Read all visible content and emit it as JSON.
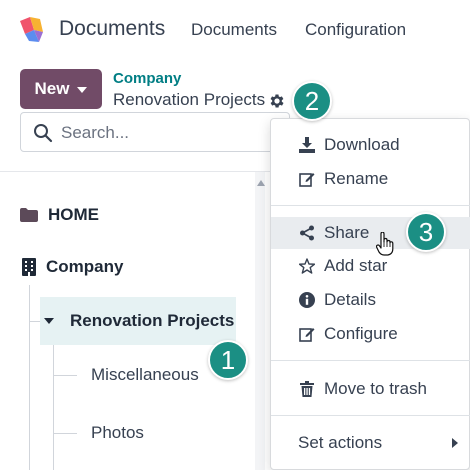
{
  "header": {
    "app_name": "Documents",
    "nav": [
      "Documents",
      "Configuration"
    ]
  },
  "control_panel": {
    "new_label": "New",
    "breadcrumb_parent": "Company",
    "breadcrumb_current": "Renovation Projects",
    "search_placeholder": "Search..."
  },
  "tree": {
    "items": [
      {
        "label": "HOME",
        "icon": "folder-icon"
      },
      {
        "label": "Company",
        "icon": "building-icon"
      },
      {
        "label": "Renovation Projects",
        "icon": "caret-down-icon",
        "selected": true
      },
      {
        "label": "Miscellaneous"
      },
      {
        "label": "Photos"
      }
    ]
  },
  "menu": {
    "items": [
      {
        "label": "Download",
        "icon": "download-icon"
      },
      {
        "label": "Rename",
        "icon": "edit-icon"
      },
      {
        "label": "Share",
        "icon": "share-icon",
        "hovered": true
      },
      {
        "label": "Add star",
        "icon": "star-icon"
      },
      {
        "label": "Details",
        "icon": "info-icon"
      },
      {
        "label": "Configure",
        "icon": "edit-icon"
      },
      {
        "label": "Move to trash",
        "icon": "trash-icon"
      },
      {
        "label": "Set actions",
        "icon": "caret-right-icon"
      }
    ]
  },
  "callouts": [
    "1",
    "2",
    "3"
  ],
  "colors": {
    "brand": "#714B67",
    "accent": "#017E84",
    "callout": "#1b8f84",
    "selected_bg": "#e6f2f3"
  }
}
